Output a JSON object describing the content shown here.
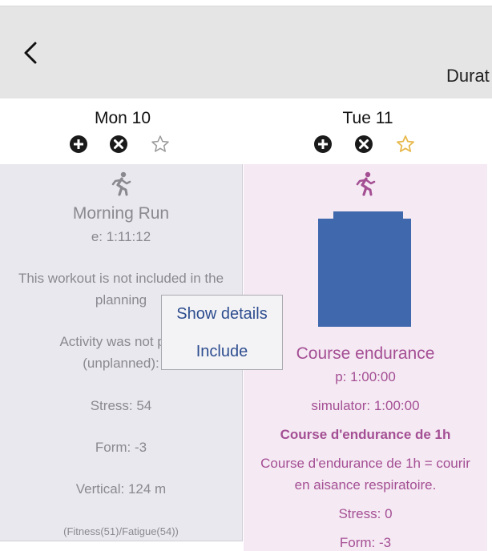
{
  "topbar": {
    "title": "Durat"
  },
  "days": [
    {
      "label": "Mon 10"
    },
    {
      "label": "Tue 11"
    }
  ],
  "monday": {
    "title": "Morning Run",
    "time": "e: 1:11:12",
    "notice_line1": "This workout is not included in the",
    "notice_line2": "planning",
    "activity_line1": "Activity was not pl",
    "activity_line2": "(unplanned):",
    "stress": "Stress: 54",
    "form": "Form: -3",
    "vertical": "Vertical: 124 m",
    "fitness": "(Fitness(51)/Fatigue(54))"
  },
  "tuesday": {
    "title": "Course endurance",
    "planned": "p: 1:00:00",
    "simulator": "simulator: 1:00:00",
    "bold_title": "Course d'endurance de 1h",
    "desc_line1": "Course d'endurance de 1h = courir",
    "desc_line2": "en aisance respiratoire.",
    "stress": "Stress: 0",
    "form": "Form: -3"
  },
  "popup": {
    "show_details": "Show details",
    "include": "Include"
  },
  "colors": {
    "monday_bg": "#e9e8ee",
    "tuesday_bg": "#f5e9f3",
    "tuesday_text": "#a44f94",
    "image_blue": "#3f68ad",
    "star_active": "#e8b84c",
    "popup_link": "#2e4d8f"
  },
  "icons": {
    "back": "chevron-left-icon",
    "add": "plus-circle-icon",
    "remove": "x-circle-icon",
    "favorite": "star-icon",
    "run": "running-person-icon"
  }
}
